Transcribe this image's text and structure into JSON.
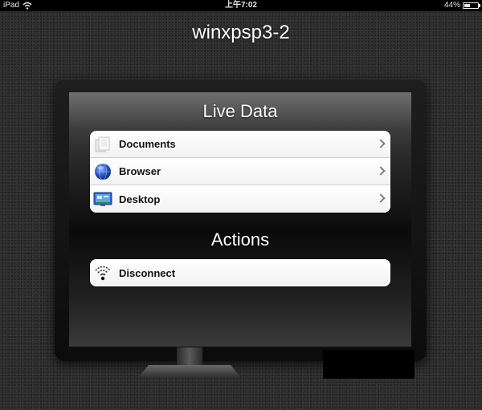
{
  "status_bar": {
    "device": "iPad",
    "time": "上午7:02",
    "battery": "44%",
    "battery_level": 0.44
  },
  "title": "winxpsp3-2",
  "sections": [
    {
      "header": "Live Data",
      "items": [
        {
          "label": "Documents",
          "icon": "documents-icon"
        },
        {
          "label": "Browser",
          "icon": "globe-icon"
        },
        {
          "label": "Desktop",
          "icon": "desktop-icon"
        }
      ]
    },
    {
      "header": "Actions",
      "items": [
        {
          "label": "Disconnect",
          "icon": "wifi-signal-icon"
        }
      ]
    }
  ],
  "colors": {
    "background": "#2a2a2a",
    "row_background": "#ffffff",
    "row_text": "#111111",
    "header_text": "#ffffff",
    "chevron": "#7f7f7f"
  }
}
